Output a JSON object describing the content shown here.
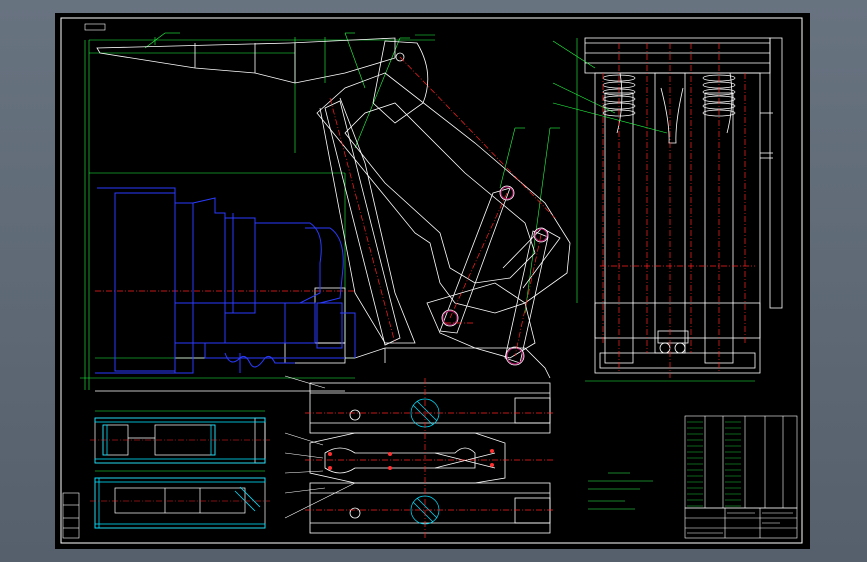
{
  "sheet": {
    "tag_top_left": "",
    "title_block_name": "",
    "title_block_code": ""
  },
  "technical_requirements": {
    "heading": "",
    "lines": [
      "",
      "",
      "",
      ""
    ]
  },
  "colors": {
    "background": "#000000",
    "viewport": "#5f6a76",
    "frame": "#ffffff",
    "outline": "#ffffff",
    "centerline": "#ff2020",
    "leader": "#22ff44",
    "hidden_part": "#2a3cff",
    "hatch": "#00e0ff",
    "text_yellow": "#ffff66",
    "text_green": "#33ff55"
  },
  "icons": {
    "drawing": "cad-drawing-icon"
  }
}
